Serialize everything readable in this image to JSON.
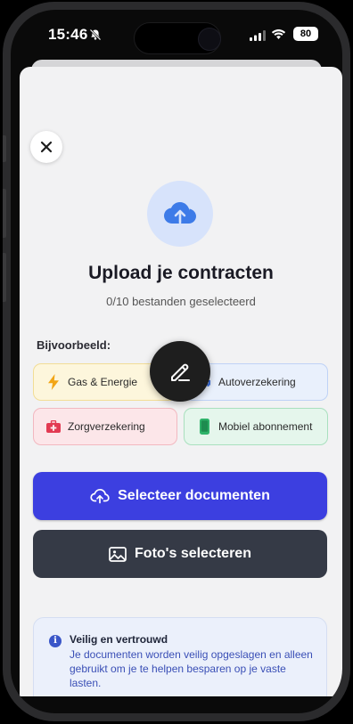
{
  "status_bar": {
    "time": "15:46",
    "battery": "80",
    "icons": [
      "bell-slash-icon",
      "cellular-signal-icon",
      "wifi-icon",
      "battery-icon"
    ]
  },
  "header": {
    "close_icon": "close-icon"
  },
  "hero": {
    "icon": "cloud-upload-icon",
    "title": "Upload je contracten",
    "subtitle": "0/10 bestanden geselecteerd"
  },
  "examples": {
    "label": "Bijvoorbeeld:",
    "chips": [
      {
        "label": "Gas & Energie",
        "icon": "lightning-icon",
        "color": "#f2a516"
      },
      {
        "label": "Autoverzekering",
        "icon": "car-icon",
        "color": "#3a6fe0"
      },
      {
        "label": "Zorgverzekering",
        "icon": "first-aid-kit-icon",
        "color": "#e23a52"
      },
      {
        "label": "Mobiel abonnement",
        "icon": "smartphone-icon",
        "color": "#2fb36a"
      }
    ]
  },
  "overlay": {
    "icon": "pencil-edit-icon"
  },
  "actions": {
    "select_documents": "Selecteer documenten",
    "select_photos": "Foto's selecteren",
    "primary_color": "#3c3fe0",
    "secondary_color": "#353a46"
  },
  "info": {
    "icon": "info-icon",
    "title": "Veilig en vertrouwd",
    "text": "Je documenten worden veilig opgeslagen en alleen gebruikt om je te helpen besparen op je vaste lasten."
  }
}
